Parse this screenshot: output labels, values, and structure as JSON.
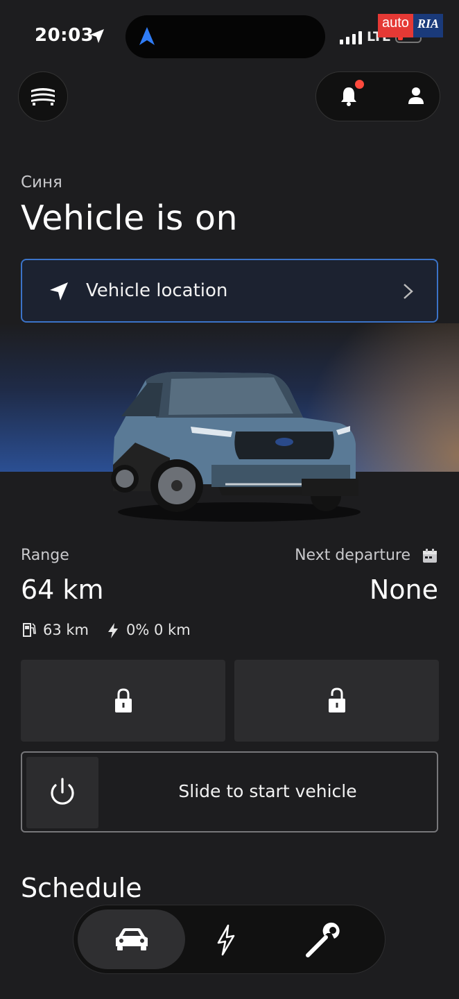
{
  "status_bar": {
    "time": "20:03",
    "network": "LTE",
    "battery_color": "#ff3b30"
  },
  "watermark": {
    "part1": "auto",
    "part2": "RIA"
  },
  "vehicle": {
    "name": "Синя",
    "status": "Vehicle is on"
  },
  "location_button": {
    "label": "Vehicle location"
  },
  "stats": {
    "range_label": "Range",
    "range_value": "64 km",
    "departure_label": "Next departure",
    "departure_value": "None",
    "fuel_range": "63 km",
    "electric_range": "0% 0 km"
  },
  "slider": {
    "label": "Slide to start vehicle"
  },
  "section": {
    "schedule": "Schedule"
  },
  "colors": {
    "accent_border": "#3b73c8",
    "notification_dot": "#ff4a3d",
    "tile_bg": "#2c2c2e"
  },
  "icons": {
    "menu": "stack-menu-icon",
    "bell": "bell-icon",
    "profile": "person-icon",
    "location": "navigation-arrow-icon",
    "calendar": "calendar-icon",
    "lock": "lock-icon",
    "unlock": "unlock-icon",
    "power": "power-icon",
    "tabs": [
      "car-icon",
      "bolt-icon",
      "wrench-icon"
    ]
  }
}
